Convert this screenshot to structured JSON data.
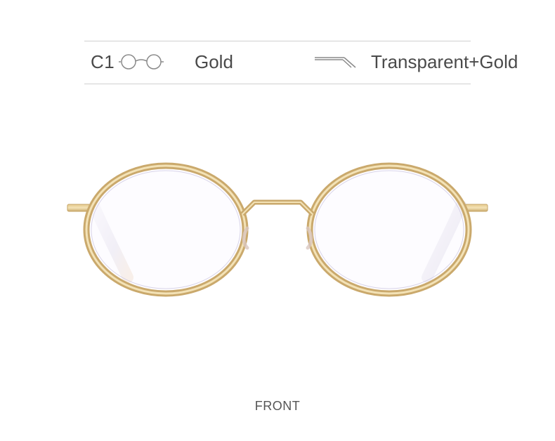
{
  "color_option": {
    "code": "C1",
    "code_icon": "glasses-outline-icon",
    "color_name": "Gold",
    "material_icon": "temple-arm-icon",
    "material_name": "Transparent+Gold"
  },
  "product_image": {
    "icon": "oval-glasses-front-view",
    "frame_color": "#d8b878",
    "frame_highlight": "#f2dfb0",
    "temple_color": "#e8e4ee"
  },
  "view_label": "FRONT"
}
